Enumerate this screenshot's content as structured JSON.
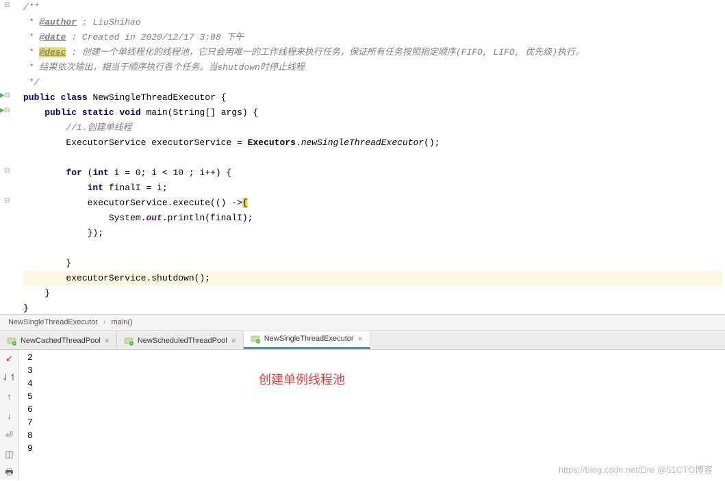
{
  "javadoc": {
    "author_tag": "@author",
    "author_text": " : LiuShihao",
    "date_tag": "@date",
    "date_text": " : Created in 2020/12/17 3:08 下午",
    "desc_tag": "@desc",
    "desc_text": " : 创建一个单线程化的线程池，它只会用唯一的工作线程来执行任务，保证所有任务按照指定顺序(FIFO, LIFO, 优先级)执行。",
    "desc_line2": " * 结果依次输出，相当于顺序执行各个任务。当shutdown时停止线程"
  },
  "code": {
    "public": "public",
    "class": "class",
    "class_name": "NewSingleThreadExecutor",
    "static": "static",
    "void": "void",
    "main": "main",
    "main_params": "(String[] args) {",
    "comment1": "//1.创建单线程",
    "exec_service": "ExecutorService executorService = ",
    "executors": "Executors",
    "new_single": "newSingleThreadExecutor",
    "for": "for",
    "int": "int",
    "for_init": " i = 0; i < 10 ; i++) {",
    "finalI": " finalI = i;",
    "execute": "executorService.execute(() ->",
    "system": "System.",
    "out": "out",
    "println": ".println(finalI);",
    "close_lambda": "});",
    "shutdown": "executorService.shutdown();"
  },
  "breadcrumb": {
    "item1": "NewSingleThreadExecutor",
    "item2": "main()"
  },
  "tabs": [
    {
      "label": "NewCachedThreadPool",
      "active": false
    },
    {
      "label": "NewScheduledThreadPool",
      "active": false
    },
    {
      "label": "NewSingleThreadExecutor",
      "active": true
    }
  ],
  "console_output": [
    "2",
    "3",
    "4",
    "5",
    "6",
    "7",
    "8",
    "9"
  ],
  "annotation": "创建单例线程池",
  "watermark": "https://blog.csdn.net/Dre @51CTO博客"
}
